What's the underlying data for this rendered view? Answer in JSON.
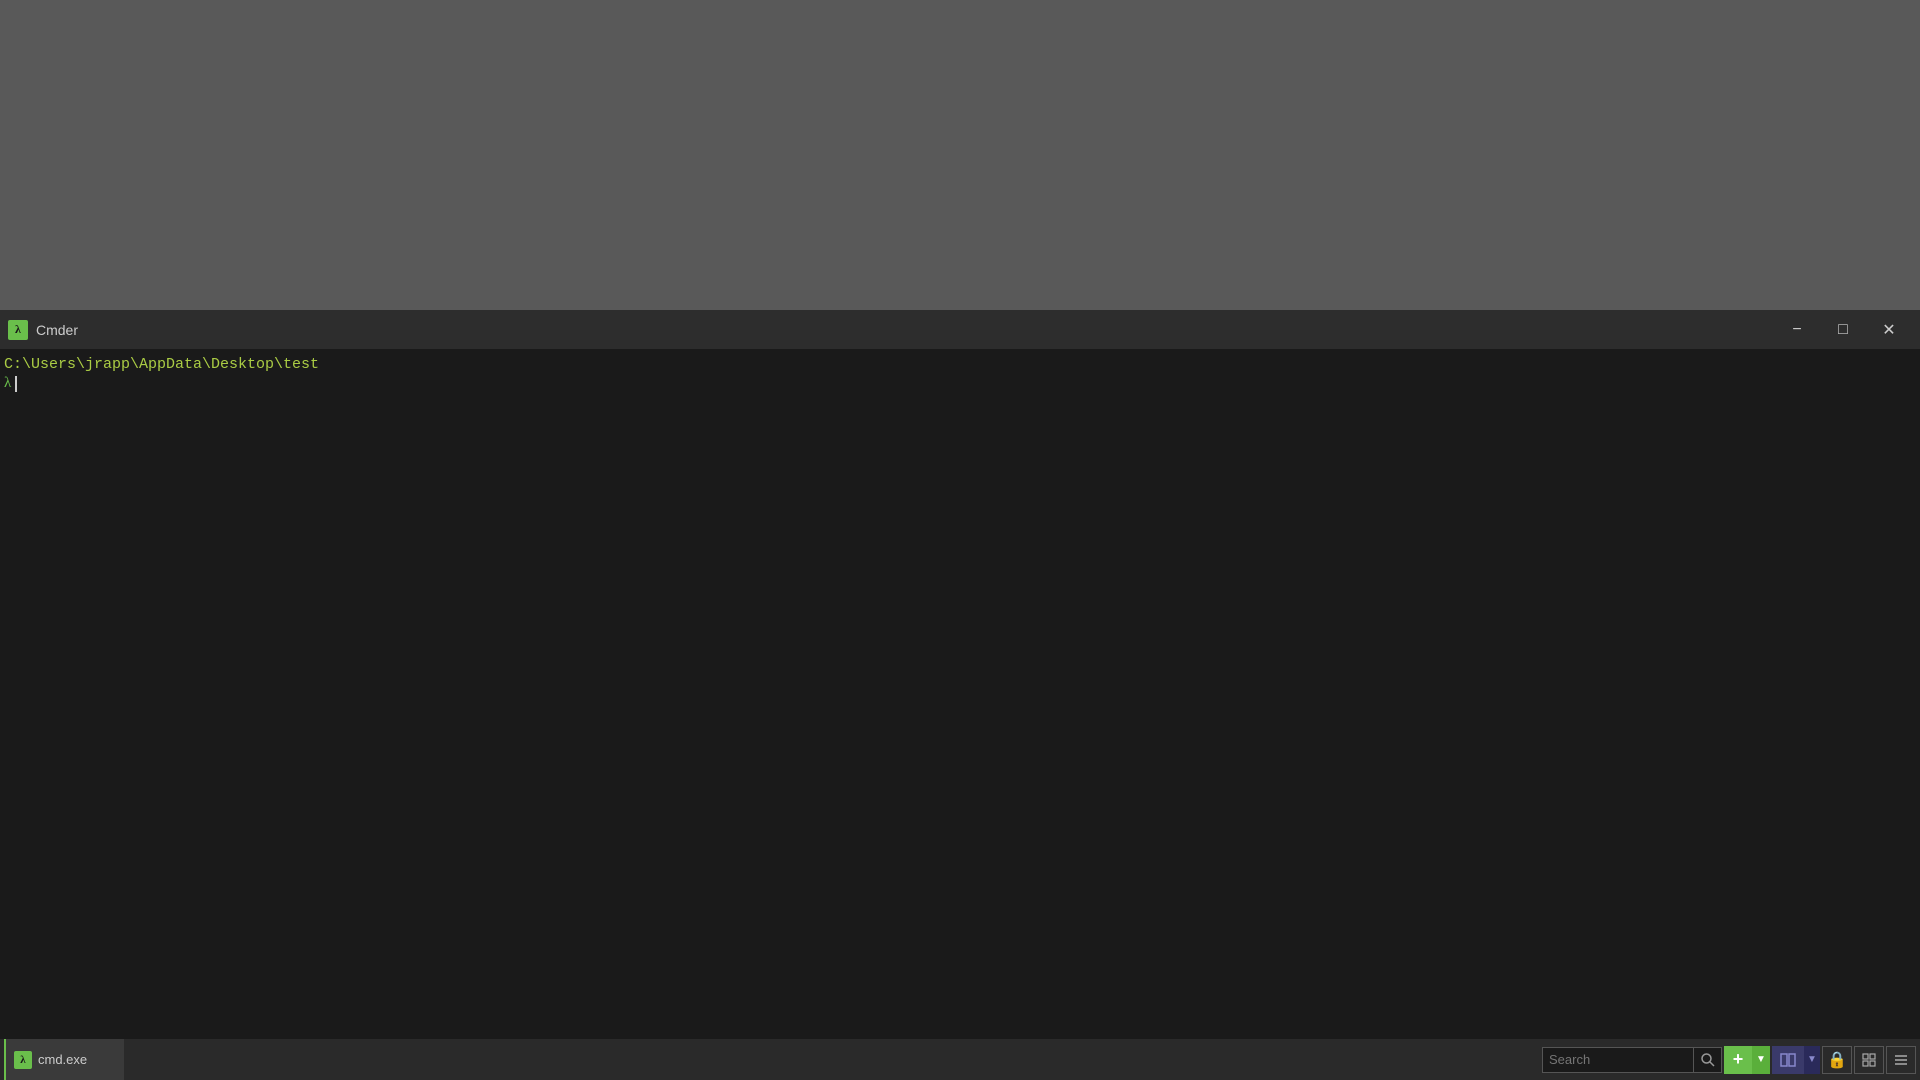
{
  "desktop": {
    "background_color": "#595959"
  },
  "title_bar": {
    "icon_symbol": "λ",
    "title": "Cmder",
    "minimize_label": "−",
    "maximize_label": "□",
    "close_label": "✕"
  },
  "terminal": {
    "background_color": "#1a1a1a",
    "path_line": "C:\\Users\\jrapp\\AppData\\Desktop\\test",
    "prompt_symbol": "λ",
    "path_color": "#aacc44",
    "prompt_color": "#6abf4b"
  },
  "taskbar": {
    "app_label": "cmd.exe",
    "app_icon_symbol": "λ",
    "search_placeholder": "Search",
    "search_button_icon": "🔍"
  }
}
